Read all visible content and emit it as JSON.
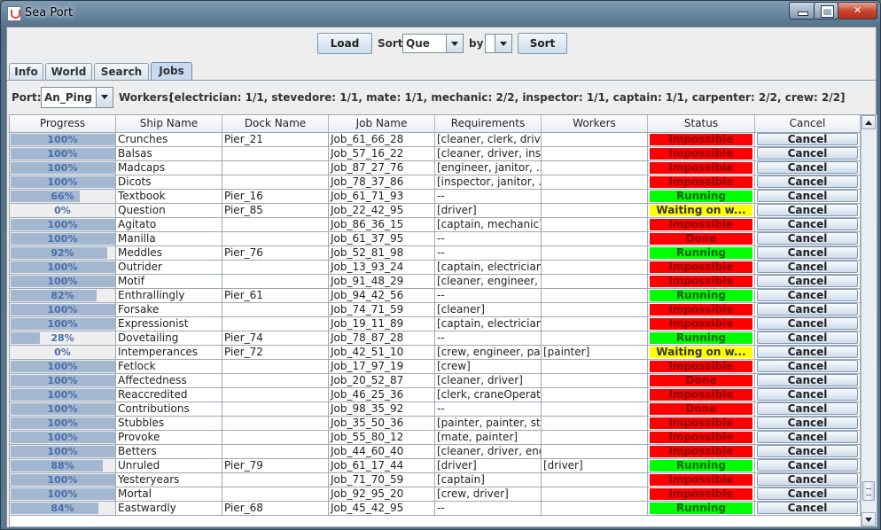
{
  "window": {
    "title": "Sea Port"
  },
  "toolbar": {
    "load_label": "Load",
    "sort_label": "Sort",
    "sort_value": "Que",
    "by_label": "by",
    "by_value": "",
    "sort_button_label": "Sort"
  },
  "tabs": [
    {
      "label": "Info",
      "active": false
    },
    {
      "label": "World",
      "active": false
    },
    {
      "label": "Search",
      "active": false
    },
    {
      "label": "Jobs",
      "active": true
    }
  ],
  "port_bar": {
    "port_label": "Port:",
    "port_value": "An_Ping",
    "workers_label": "Workers:",
    "workers_value": "[electrician: 1/1, stevedore: 1/1, mate: 1/1, mechanic: 2/2, inspector: 1/1, captain: 1/1, carpenter: 2/2, crew: 2/2]"
  },
  "table": {
    "columns": [
      "Progress",
      "Ship Name",
      "Dock Name",
      "Job Name",
      "Requirements",
      "Workers",
      "Status",
      "Cancel"
    ],
    "rows": [
      {
        "progress": 100,
        "progress_label": "100%",
        "ship": "Crunches",
        "dock": "Pier_21",
        "job": "Job_61_66_28",
        "req": "[cleaner, clerk, driver]",
        "workers": "",
        "status": "Impossible",
        "cancel": "Cancel"
      },
      {
        "progress": 100,
        "progress_label": "100%",
        "ship": "Balsas",
        "dock": "",
        "job": "Job_57_16_22",
        "req": "[cleaner, driver, ins...",
        "workers": "",
        "status": "Impossible",
        "cancel": "Cancel"
      },
      {
        "progress": 100,
        "progress_label": "100%",
        "ship": "Madcaps",
        "dock": "",
        "job": "Job_87_27_76",
        "req": "[engineer, janitor, ...",
        "workers": "",
        "status": "Impossible",
        "cancel": "Cancel"
      },
      {
        "progress": 100,
        "progress_label": "100%",
        "ship": "Dicots",
        "dock": "",
        "job": "Job_78_37_86",
        "req": "[inspector, janitor, ...",
        "workers": "",
        "status": "Impossible",
        "cancel": "Cancel"
      },
      {
        "progress": 66,
        "progress_label": "66%",
        "ship": "Textbook",
        "dock": "Pier_16",
        "job": "Job_61_71_93",
        "req": "--",
        "workers": "",
        "status": "Running",
        "cancel": "Cancel"
      },
      {
        "progress": 0,
        "progress_label": "0%",
        "ship": "Question",
        "dock": "Pier_85",
        "job": "Job_22_42_95",
        "req": "[driver]",
        "workers": "",
        "status": "Waiting on w...",
        "cancel": "Cancel"
      },
      {
        "progress": 100,
        "progress_label": "100%",
        "ship": "Agitato",
        "dock": "",
        "job": "Job_86_36_15",
        "req": "[captain, mechanic]",
        "workers": "",
        "status": "Impossible",
        "cancel": "Cancel"
      },
      {
        "progress": 100,
        "progress_label": "100%",
        "ship": "Manilla",
        "dock": "",
        "job": "Job_61_37_95",
        "req": "--",
        "workers": "",
        "status": "Done",
        "cancel": "Cancel"
      },
      {
        "progress": 92,
        "progress_label": "92%",
        "ship": "Meddles",
        "dock": "Pier_76",
        "job": "Job_52_81_98",
        "req": "--",
        "workers": "",
        "status": "Running",
        "cancel": "Cancel"
      },
      {
        "progress": 100,
        "progress_label": "100%",
        "ship": "Outrider",
        "dock": "",
        "job": "Job_13_93_24",
        "req": "[captain, electrician,...",
        "workers": "",
        "status": "Impossible",
        "cancel": "Cancel"
      },
      {
        "progress": 100,
        "progress_label": "100%",
        "ship": "Motif",
        "dock": "",
        "job": "Job_91_48_29",
        "req": "[cleaner, engineer, ...",
        "workers": "",
        "status": "Impossible",
        "cancel": "Cancel"
      },
      {
        "progress": 82,
        "progress_label": "82%",
        "ship": "Enthrallingly",
        "dock": "Pier_61",
        "job": "Job_94_42_56",
        "req": "--",
        "workers": "",
        "status": "Running",
        "cancel": "Cancel"
      },
      {
        "progress": 100,
        "progress_label": "100%",
        "ship": "Forsake",
        "dock": "",
        "job": "Job_74_71_59",
        "req": "[cleaner]",
        "workers": "",
        "status": "Impossible",
        "cancel": "Cancel"
      },
      {
        "progress": 100,
        "progress_label": "100%",
        "ship": "Expressionist",
        "dock": "",
        "job": "Job_19_11_89",
        "req": "[captain, electrician,...",
        "workers": "",
        "status": "Impossible",
        "cancel": "Cancel"
      },
      {
        "progress": 28,
        "progress_label": "28%",
        "ship": "Dovetailing",
        "dock": "Pier_74",
        "job": "Job_78_87_28",
        "req": "--",
        "workers": "",
        "status": "Running",
        "cancel": "Cancel"
      },
      {
        "progress": 0,
        "progress_label": "0%",
        "ship": "Intemperances",
        "dock": "Pier_72",
        "job": "Job_42_51_10",
        "req": "[crew, engineer, pai...",
        "workers": "[painter]",
        "status": "Waiting on w...",
        "cancel": "Cancel"
      },
      {
        "progress": 100,
        "progress_label": "100%",
        "ship": "Fetlock",
        "dock": "",
        "job": "Job_17_97_19",
        "req": "[crew]",
        "workers": "",
        "status": "Impossible",
        "cancel": "Cancel"
      },
      {
        "progress": 100,
        "progress_label": "100%",
        "ship": "Affectedness",
        "dock": "",
        "job": "Job_20_52_87",
        "req": "[cleaner, driver]",
        "workers": "",
        "status": "Done",
        "cancel": "Cancel"
      },
      {
        "progress": 100,
        "progress_label": "100%",
        "ship": "Reaccredited",
        "dock": "",
        "job": "Job_46_25_36",
        "req": "[clerk, craneOperat...",
        "workers": "",
        "status": "Impossible",
        "cancel": "Cancel"
      },
      {
        "progress": 100,
        "progress_label": "100%",
        "ship": "Contributions",
        "dock": "",
        "job": "Job_98_35_92",
        "req": "--",
        "workers": "",
        "status": "Done",
        "cancel": "Cancel"
      },
      {
        "progress": 100,
        "progress_label": "100%",
        "ship": "Stubbles",
        "dock": "",
        "job": "Job_35_50_36",
        "req": "[painter, painter, ste...",
        "workers": "",
        "status": "Impossible",
        "cancel": "Cancel"
      },
      {
        "progress": 100,
        "progress_label": "100%",
        "ship": "Provoke",
        "dock": "",
        "job": "Job_55_80_12",
        "req": "[mate, painter]",
        "workers": "",
        "status": "Impossible",
        "cancel": "Cancel"
      },
      {
        "progress": 100,
        "progress_label": "100%",
        "ship": "Betters",
        "dock": "",
        "job": "Job_44_60_40",
        "req": "[cleaner, driver, eng...",
        "workers": "",
        "status": "Impossible",
        "cancel": "Cancel"
      },
      {
        "progress": 88,
        "progress_label": "88%",
        "ship": "Unruled",
        "dock": "Pier_79",
        "job": "Job_61_17_44",
        "req": "[driver]",
        "workers": "[driver]",
        "status": "Running",
        "cancel": "Cancel"
      },
      {
        "progress": 100,
        "progress_label": "100%",
        "ship": "Yesteryears",
        "dock": "",
        "job": "Job_71_70_59",
        "req": "[captain]",
        "workers": "",
        "status": "Impossible",
        "cancel": "Cancel"
      },
      {
        "progress": 100,
        "progress_label": "100%",
        "ship": "Mortal",
        "dock": "",
        "job": "Job_92_95_20",
        "req": "[crew, driver]",
        "workers": "",
        "status": "Impossible",
        "cancel": "Cancel"
      },
      {
        "progress": 84,
        "progress_label": "84%",
        "ship": "Eastwardly",
        "dock": "Pier_68",
        "job": "Job_45_42_95",
        "req": "--",
        "workers": "",
        "status": "Running",
        "cancel": "Cancel"
      }
    ]
  },
  "status_colors": {
    "Impossible": {
      "bg": "#ff0000",
      "fg": "#8b0000"
    },
    "Done": {
      "bg": "#ff0000",
      "fg": "#8b0000"
    },
    "Running": {
      "bg": "#00ff00",
      "fg": "#006400"
    },
    "Waiting on w...": {
      "bg": "#ffff00",
      "fg": "#333333"
    }
  }
}
